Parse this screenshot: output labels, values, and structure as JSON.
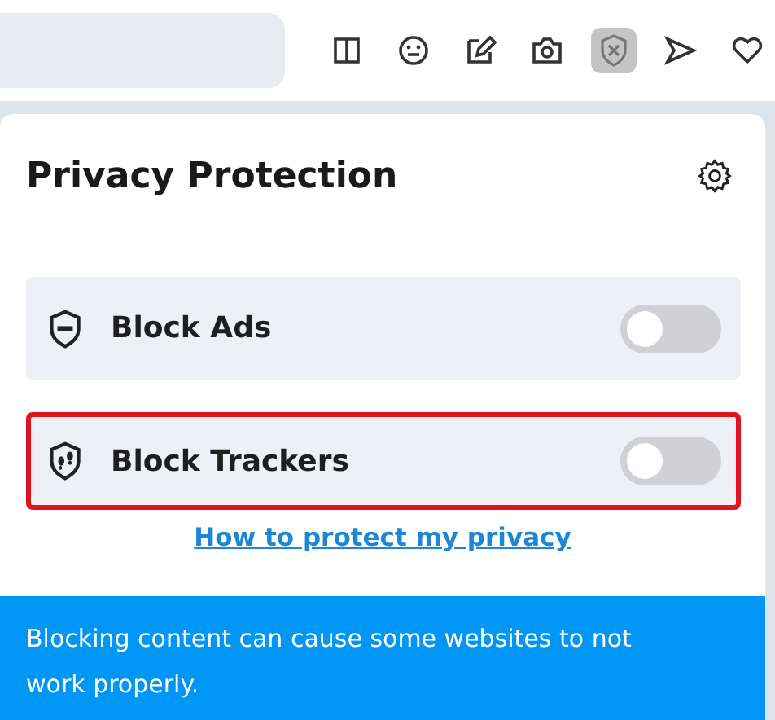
{
  "toolbar": {
    "buttons": [
      {
        "kind": "book",
        "selected": false
      },
      {
        "kind": "emoji",
        "selected": false
      },
      {
        "kind": "pen",
        "selected": false
      },
      {
        "kind": "camera",
        "selected": false
      },
      {
        "kind": "shield",
        "selected": true
      },
      {
        "kind": "send",
        "selected": false
      },
      {
        "kind": "heart",
        "selected": false
      }
    ]
  },
  "popup": {
    "title": "Privacy Protection",
    "options": [
      {
        "kind": "ads",
        "label": "Block Ads",
        "on": false,
        "highlighted": false
      },
      {
        "kind": "trackers",
        "label": "Block Trackers",
        "on": false,
        "highlighted": true
      }
    ],
    "link": "How to protect my privacy",
    "notice": "Blocking content can cause some websites to not work properly."
  }
}
